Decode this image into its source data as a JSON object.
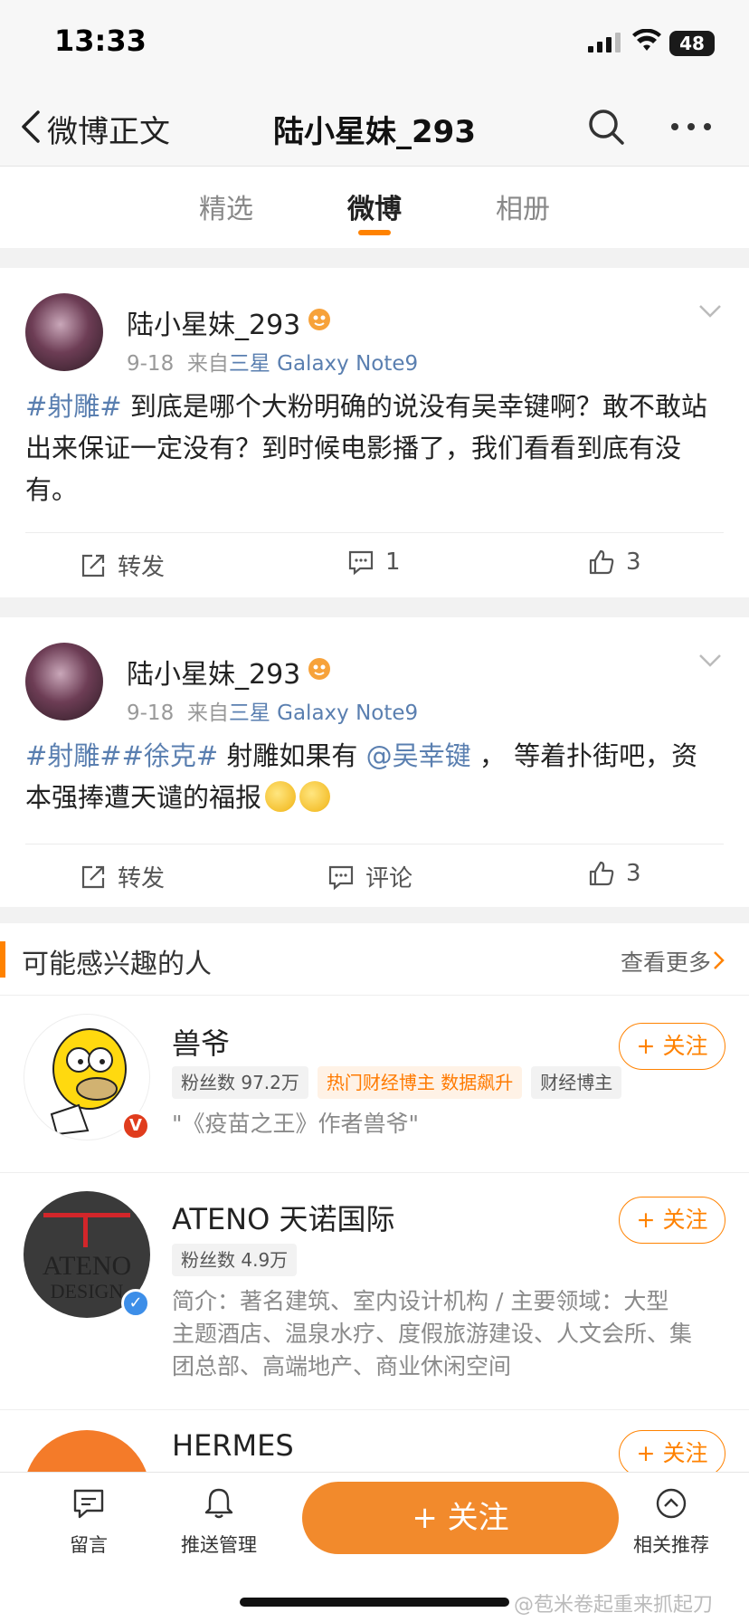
{
  "status_bar": {
    "time": "13:33",
    "battery": "48"
  },
  "nav": {
    "back_label": "微博正文",
    "title": "陆小星妹_293"
  },
  "tabs": [
    {
      "label": "精选"
    },
    {
      "label": "微博"
    },
    {
      "label": "相册"
    }
  ],
  "posts": [
    {
      "username": "陆小星妹_293",
      "date": "9-18",
      "from_prefix": "来自",
      "source": "三星 Galaxy Note9",
      "tag1": "#射雕#",
      "text": " 到底是哪个大粉明确的说没有吴幸键啊？敢不敢站出来保证一定没有？到时候电影播了，我们看看到底有没有。",
      "repost_label": "转发",
      "comment_count": "1",
      "like_count": "3"
    },
    {
      "username": "陆小星妹_293",
      "date": "9-18",
      "from_prefix": "来自",
      "source": "三星 Galaxy Note9",
      "tag1": "#射雕#",
      "tag2": "#徐克#",
      "text_a": " 射雕如果有 ",
      "mention": "@吴幸键",
      "text_b": " ，  等着扑街吧，资本强捧遭天谴的福报",
      "repost_label": "转发",
      "comment_label": "评论",
      "like_count": "3"
    }
  ],
  "recommend": {
    "title": "可能感兴趣的人",
    "more": "查看更多",
    "follow_label": "+ 关注",
    "people": [
      {
        "name": "兽爷",
        "chips": [
          "粉丝数 97.2万",
          "热门财经博主 数据飙升",
          "财经博主"
        ],
        "desc": "\"《疫苗之王》作者兽爷\""
      },
      {
        "name": "ATENO 天诺国际",
        "avatar_text": "ATENO",
        "avatar_sub": "DESIGN",
        "chips": [
          "粉丝数 4.9万"
        ],
        "desc_lines": [
          "简介：著名建筑、室内设计机构 / 主要领域：大型",
          "主题酒店、温泉水疗、度假旅游建设、人文会所、集",
          "团总部、高端地产、商业休闲空间"
        ]
      },
      {
        "name": "HERMES"
      }
    ]
  },
  "bottom_bar": {
    "message": "留言",
    "push": "推送管理",
    "follow": "+ 关注",
    "related": "相关推荐",
    "watermark": "@苞米卷起重来抓起刀"
  },
  "colors": {
    "accent": "#ff8200",
    "link": "#5a7fb0"
  }
}
